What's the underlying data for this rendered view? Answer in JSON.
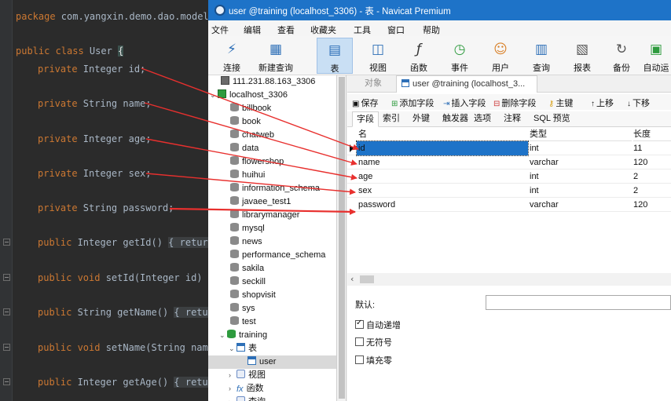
{
  "ide": {
    "lines": [
      "package com.yangxin.demo.dao.model",
      "public class User {",
      "private Integer id;",
      "private String name;",
      "private Integer age;",
      "private Integer sex;",
      "private String password;",
      "public Integer getId() { retur",
      "public void setId(Integer id)",
      "public String getName() { retu",
      "public void setName(String name",
      "public Integer getAge() { retu"
    ]
  },
  "window": {
    "title": "user @training (localhost_3306) - 表 - Navicat Premium"
  },
  "menu": [
    "文件",
    "编辑",
    "查看",
    "收藏夹",
    "工具",
    "窗口",
    "帮助"
  ],
  "toolbar": {
    "items": [
      {
        "label": "连接",
        "icon": "plug-icon"
      },
      {
        "label": "新建查询",
        "icon": "new-query-icon"
      },
      {
        "label": "表",
        "icon": "table-icon"
      },
      {
        "label": "视图",
        "icon": "view-icon"
      },
      {
        "label": "函数",
        "icon": "function-icon"
      },
      {
        "label": "事件",
        "icon": "clock-icon"
      },
      {
        "label": "用户",
        "icon": "user-icon"
      },
      {
        "label": "查询",
        "icon": "query-icon"
      },
      {
        "label": "报表",
        "icon": "report-icon"
      },
      {
        "label": "备份",
        "icon": "backup-icon"
      },
      {
        "label": "自动运",
        "icon": "automation-icon"
      }
    ]
  },
  "tree": {
    "connections": [
      "111.231.88.163_3306",
      "localhost_3306"
    ],
    "databases": [
      "billbook",
      "book",
      "chatweb",
      "data",
      "flowershop",
      "huihui",
      "information_schema",
      "javaee_test1",
      "librarymanager",
      "mysql",
      "news",
      "performance_schema",
      "sakila",
      "seckill",
      "shopvisit",
      "sys",
      "test",
      "training"
    ],
    "training_children": {
      "tables": "表",
      "table_user": "user",
      "views": "视图",
      "functions": "函数",
      "queries": "查询"
    }
  },
  "tabs": {
    "objects": "对象",
    "active": "user @training (localhost_3..."
  },
  "actions": [
    "保存",
    "添加字段",
    "插入字段",
    "删除字段",
    "主键",
    "上移",
    "下移"
  ],
  "subtabs": [
    "字段",
    "索引",
    "外键",
    "触发器",
    "选项",
    "注释",
    "SQL 预览"
  ],
  "grid": {
    "headers": {
      "name": "名",
      "type": "类型",
      "length": "长度"
    },
    "rows": [
      {
        "name": "id",
        "type": "int",
        "length": "11"
      },
      {
        "name": "name",
        "type": "varchar",
        "length": "120"
      },
      {
        "name": "age",
        "type": "int",
        "length": "2"
      },
      {
        "name": "sex",
        "type": "int",
        "length": "2"
      },
      {
        "name": "password",
        "type": "varchar",
        "length": "120"
      }
    ]
  },
  "props": {
    "default_label": "默认:",
    "auto_increment": "自动递增",
    "unsigned": "无符号",
    "zerofill": "填充零"
  },
  "colors": {
    "titlebar": "#1e73c8",
    "selection": "#1e73c8",
    "annotation": "#e8302e",
    "ide_bg": "#2b2b2b",
    "keyword": "#cc7832"
  }
}
